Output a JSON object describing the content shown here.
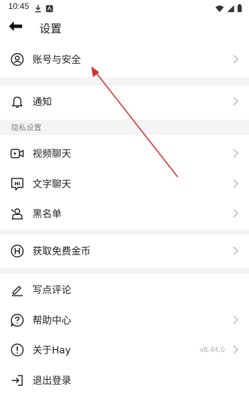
{
  "status_bar": {
    "time": "10:45",
    "left_icons": [
      "download-icon",
      "notification-app-icon"
    ],
    "right_icons": [
      "wifi-icon",
      "signal-icon",
      "battery-icon"
    ]
  },
  "header": {
    "title": "设置",
    "back_icon": "back-arrow-icon"
  },
  "sections": {
    "account": {
      "label": "账号与安全",
      "icon": "user-circle-icon"
    },
    "notifications": {
      "label": "通知",
      "icon": "bell-icon"
    },
    "privacy_header": "隐私设置",
    "video_chat": {
      "label": "视频聊天",
      "icon": "video-icon"
    },
    "text_chat": {
      "label": "文字聊天",
      "icon": "chat-hi-icon"
    },
    "blacklist": {
      "label": "黑名单",
      "icon": "blacklist-icon"
    },
    "free_coins": {
      "label": "获取免费金币",
      "icon": "coin-h-icon"
    },
    "review": {
      "label": "写点评论",
      "icon": "pen-icon"
    },
    "help": {
      "label": "帮助中心",
      "icon": "help-icon"
    },
    "about": {
      "label": "关于Hay",
      "icon": "info-icon",
      "version": "v8.44.0"
    },
    "logout": {
      "label": "退出登录",
      "icon": "logout-icon"
    }
  },
  "colors": {
    "annotation_arrow": "#d32f2f",
    "section_bg": "#f4f4f4",
    "chevron": "#b8b8b8"
  }
}
